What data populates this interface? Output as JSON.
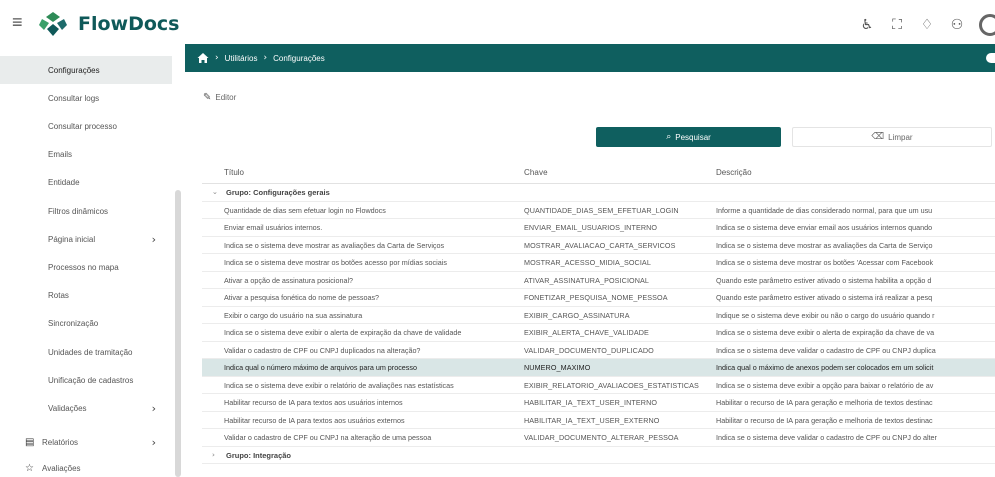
{
  "app": {
    "brand": "FlowDocs"
  },
  "header": {
    "icons": [
      "accessibility-icon",
      "expand-icon",
      "bell-icon",
      "users-icon",
      "avatar"
    ],
    "icon_glyphs": [
      "♿",
      "⛶",
      "♢",
      "⚇"
    ]
  },
  "sidebar": {
    "items": [
      {
        "label": "Configurações",
        "active": true,
        "chevron": ""
      },
      {
        "label": "Consultar logs",
        "active": false,
        "chevron": ""
      },
      {
        "label": "Consultar processo",
        "active": false,
        "chevron": ""
      },
      {
        "label": "Emails",
        "active": false,
        "chevron": ""
      },
      {
        "label": "Entidade",
        "active": false,
        "chevron": ""
      },
      {
        "label": "Filtros dinâmicos",
        "active": false,
        "chevron": ""
      },
      {
        "label": "Página inicial",
        "active": false,
        "chevron": "›"
      },
      {
        "label": "Processos no mapa",
        "active": false,
        "chevron": ""
      },
      {
        "label": "Rotas",
        "active": false,
        "chevron": ""
      },
      {
        "label": "Sincronização",
        "active": false,
        "chevron": ""
      },
      {
        "label": "Unidades de tramitação",
        "active": false,
        "chevron": ""
      },
      {
        "label": "Unificação de cadastros",
        "active": false,
        "chevron": ""
      },
      {
        "label": "Validações",
        "active": false,
        "chevron": "›"
      }
    ],
    "sections": [
      {
        "label": "Relatórios",
        "icon": "report-icon",
        "glyph": "▤",
        "chevron": "›"
      },
      {
        "label": "Avaliações",
        "icon": "star-icon",
        "glyph": "☆",
        "chevron": ""
      }
    ]
  },
  "breadcrumb": {
    "items": [
      "Utilitários",
      "Configurações"
    ],
    "separator": "›"
  },
  "toolbar": {
    "editor_label": "Editor",
    "editor_glyph": "✎"
  },
  "actions": {
    "search_label": "Pesquisar",
    "search_glyph": "⌕",
    "clear_label": "Limpar",
    "clear_glyph": "⌫"
  },
  "table": {
    "columns": [
      "Título",
      "Chave",
      "Descrição"
    ],
    "groups": [
      {
        "label": "Grupo: Configurações gerais",
        "toggle": "⌄",
        "rows": [
          {
            "titulo": "Quantidade de dias sem efetuar login no Flowdocs",
            "chave": "QUANTIDADE_DIAS_SEM_EFETUAR_LOGIN",
            "descricao": "Informe a quantidade de dias considerado normal, para que um usu"
          },
          {
            "titulo": "Enviar email usuários internos.",
            "chave": "ENVIAR_EMAIL_USUARIOS_INTERNO",
            "descricao": "Indica se o sistema deve enviar email aos usuários internos quando"
          },
          {
            "titulo": "Indica se o sistema deve mostrar as avaliações da Carta de Serviços",
            "chave": "MOSTRAR_AVALIACAO_CARTA_SERVICOS",
            "descricao": "Indica se o sistema deve mostrar as avaliações da Carta de Serviço"
          },
          {
            "titulo": "Indica se o sistema deve mostrar os botões acesso por mídias sociais",
            "chave": "MOSTRAR_ACESSO_MIDIA_SOCIAL",
            "descricao": "Indica se o sistema deve mostrar os botões 'Acessar com Facebook"
          },
          {
            "titulo": "Ativar a opção de assinatura posicional?",
            "chave": "ATIVAR_ASSINATURA_POSICIONAL",
            "descricao": "Quando este parâmetro estiver ativado o sistema habilita a opção d"
          },
          {
            "titulo": "Ativar a pesquisa fonética do nome de pessoas?",
            "chave": "FONETIZAR_PESQUISA_NOME_PESSOA",
            "descricao": "Quando este parâmetro estiver ativado o sistema irá realizar a pesq"
          },
          {
            "titulo": "Exibir o cargo do usuário na sua assinatura",
            "chave": "EXIBIR_CARGO_ASSINATURA",
            "descricao": "Indique se o sistema deve exibir ou não o cargo do usuário quando r"
          },
          {
            "titulo": "Indica se o sistema deve exibir o alerta de expiração da chave de validade",
            "chave": "EXIBIR_ALERTA_CHAVE_VALIDADE",
            "descricao": "Indica se o sistema deve exibir o alerta de expiração da chave de va"
          },
          {
            "titulo": "Validar o cadastro de CPF ou CNPJ duplicados na alteração?",
            "chave": "VALIDAR_DOCUMENTO_DUPLICADO",
            "descricao": "Indica se o sistema deve validar o cadastro de CPF ou CNPJ duplica"
          },
          {
            "titulo": "Indica qual o número máximo de arquivos para um processo",
            "chave": "NUMERO_MAXIMO",
            "descricao": "Indica qual o máximo de anexos podem ser colocados em um solicit",
            "selected": true
          },
          {
            "titulo": "Indica se o sistema deve exibir o relatório de avaliações nas estatísticas",
            "chave": "EXIBIR_RELATORIO_AVALIACOES_ESTATISTICAS",
            "descricao": "Indica se o sistema deve exibir a opção para baixar o relatório de av"
          },
          {
            "titulo": "Habilitar recurso de IA para textos aos usuários internos",
            "chave": "HABILITAR_IA_TEXT_USER_INTERNO",
            "descricao": "Habilitar o recurso de IA para geração e melhoria de textos destinac"
          },
          {
            "titulo": "Habilitar recurso de IA para textos aos usuários externos",
            "chave": "HABILITAR_IA_TEXT_USER_EXTERNO",
            "descricao": "Habilitar o recurso de IA para geração e melhoria de textos destinac"
          },
          {
            "titulo": "Validar o cadastro de CPF ou CNPJ na alteração de uma pessoa",
            "chave": "VALIDAR_DOCUMENTO_ALTERAR_PESSOA",
            "descricao": "Indica se o sistema deve validar o cadastro de CPF ou CNPJ do alter"
          }
        ]
      },
      {
        "label": "Grupo: Integração",
        "toggle": "›",
        "rows": []
      }
    ]
  },
  "colors": {
    "primary": "#0f5f5f",
    "selected_row": "#d9e6e6",
    "sidebar_active": "#e9ecec"
  }
}
